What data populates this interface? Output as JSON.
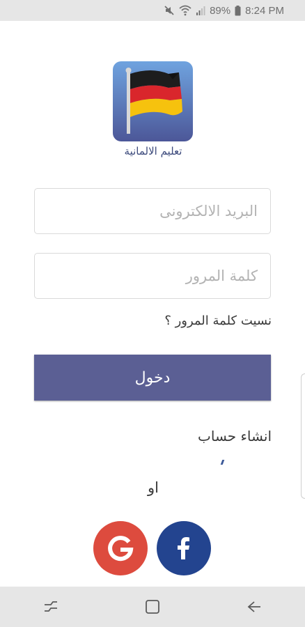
{
  "status_bar": {
    "battery": "89%",
    "time": "8:24 PM",
    "icons": [
      "mute-icon",
      "wifi-icon",
      "signal-icon",
      "battery-icon"
    ]
  },
  "logo": {
    "icon": "german-flag-icon",
    "caption": "تعليم الالمانية"
  },
  "form": {
    "email_placeholder": "البريد الالكترونى",
    "password_placeholder": "كلمة المرور",
    "forgot_password": "نسيت كلمة المرور ؟",
    "login_label": "دخول",
    "create_account": "انشاء حساب",
    "or_text": "او"
  },
  "social": {
    "google_icon": "google-icon",
    "facebook_icon": "facebook-icon"
  },
  "nav_bar": {
    "icons": [
      "recent-apps-icon",
      "home-icon",
      "back-icon"
    ]
  },
  "colors": {
    "primary_button": "#5b5f94",
    "google": "#dd4b3e",
    "facebook": "#23448f",
    "caption": "#3c4a7c"
  }
}
